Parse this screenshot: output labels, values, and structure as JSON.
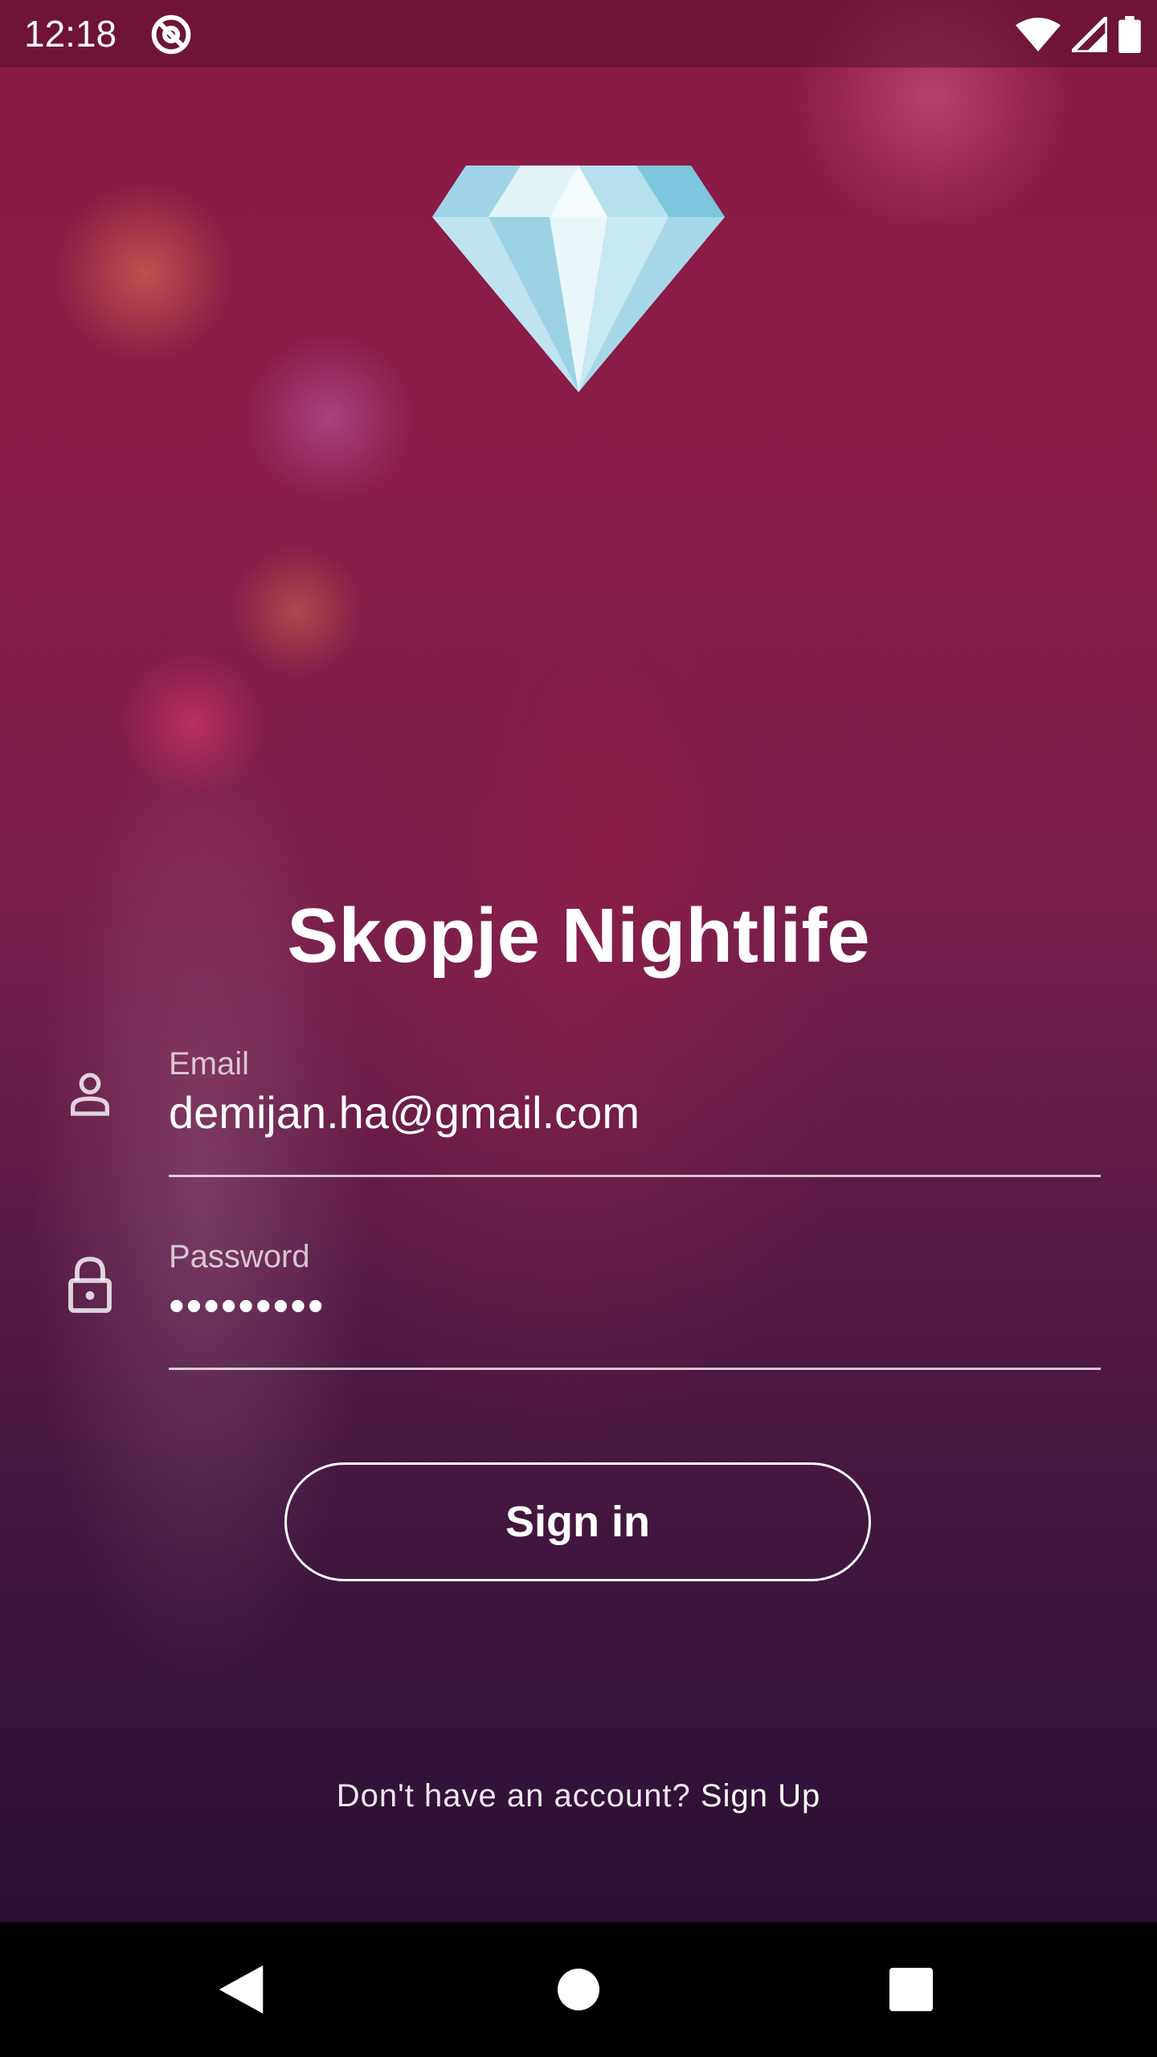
{
  "status_bar": {
    "time": "12:18",
    "icons": [
      "at-sign-icon",
      "wifi-icon",
      "signal-icon",
      "battery-icon"
    ]
  },
  "app": {
    "logo_icon": "diamond-icon",
    "title": "Skopje Nightlife"
  },
  "form": {
    "email": {
      "label": "Email",
      "value": "demijan.ha@gmail.com",
      "icon": "person-icon"
    },
    "password": {
      "label": "Password",
      "value": "•••••••••",
      "icon": "lock-icon"
    },
    "sign_in_label": "Sign in",
    "signup_prompt": "Don't have an account?",
    "signup_link": "Sign Up"
  },
  "nav_bar": {
    "icons": [
      "back-triangle-icon",
      "home-circle-icon",
      "recents-square-icon"
    ]
  },
  "colors": {
    "accent": "#8a1b46",
    "text": "#ffffff",
    "nav_bar": "#000000"
  }
}
